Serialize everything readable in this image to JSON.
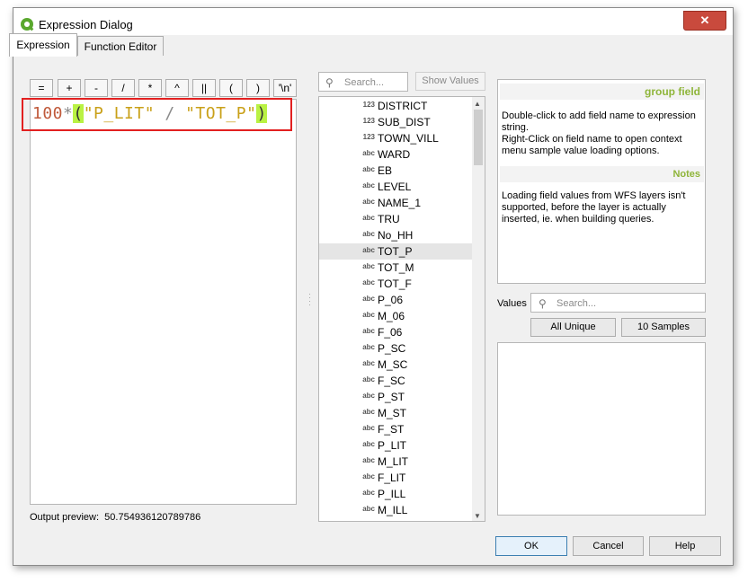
{
  "window": {
    "title": "Expression Dialog",
    "close_glyph": "✕"
  },
  "tabs": [
    {
      "label": "Expression",
      "active": true
    },
    {
      "label": "Function Editor",
      "active": false
    }
  ],
  "operators": [
    "=",
    "+",
    "-",
    "/",
    "*",
    "^",
    "||",
    "(",
    ")",
    "'\\n'"
  ],
  "expression": {
    "parts": [
      "100",
      "*",
      "(",
      "\"P_LIT\"",
      " / ",
      "\"TOT_P\"",
      ")"
    ]
  },
  "output_preview": {
    "label": "Output preview:",
    "value": "50.754936120789786"
  },
  "search": {
    "placeholder": "Search...",
    "icon": "search-icon",
    "glyph": "⚲"
  },
  "show_values_label": "Show Values",
  "fields": [
    {
      "type": "123",
      "name": "DISTRICT"
    },
    {
      "type": "123",
      "name": "SUB_DIST"
    },
    {
      "type": "123",
      "name": "TOWN_VILL"
    },
    {
      "type": "abc",
      "name": "WARD"
    },
    {
      "type": "abc",
      "name": "EB"
    },
    {
      "type": "abc",
      "name": "LEVEL"
    },
    {
      "type": "abc",
      "name": "NAME_1"
    },
    {
      "type": "abc",
      "name": "TRU"
    },
    {
      "type": "abc",
      "name": "No_HH"
    },
    {
      "type": "abc",
      "name": "TOT_P",
      "selected": true
    },
    {
      "type": "abc",
      "name": "TOT_M"
    },
    {
      "type": "abc",
      "name": "TOT_F"
    },
    {
      "type": "abc",
      "name": "P_06"
    },
    {
      "type": "abc",
      "name": "M_06"
    },
    {
      "type": "abc",
      "name": "F_06"
    },
    {
      "type": "abc",
      "name": "P_SC"
    },
    {
      "type": "abc",
      "name": "M_SC"
    },
    {
      "type": "abc",
      "name": "F_SC"
    },
    {
      "type": "abc",
      "name": "P_ST"
    },
    {
      "type": "abc",
      "name": "M_ST"
    },
    {
      "type": "abc",
      "name": "F_ST"
    },
    {
      "type": "abc",
      "name": "P_LIT"
    },
    {
      "type": "abc",
      "name": "M_LIT"
    },
    {
      "type": "abc",
      "name": "F_LIT"
    },
    {
      "type": "abc",
      "name": "P_ILL"
    },
    {
      "type": "abc",
      "name": "M_ILL"
    }
  ],
  "help": {
    "heading": "group field",
    "text1": "Double-click to add field name to expression string.",
    "text2": "Right-Click on field name to open context menu sample value loading options.",
    "notes_heading": "Notes",
    "notes_text": "Loading field values from WFS layers isn't supported, before the layer is actually inserted, ie. when building queries."
  },
  "values": {
    "label": "Values",
    "search_placeholder": "Search...",
    "all_unique_label": "All Unique",
    "samples_label": "10 Samples"
  },
  "buttons": {
    "ok": "OK",
    "cancel": "Cancel",
    "help": "Help"
  },
  "colors": {
    "accent": "#8fb53a",
    "highlight_box": "#e22020",
    "paren_match": "#b9f243"
  }
}
